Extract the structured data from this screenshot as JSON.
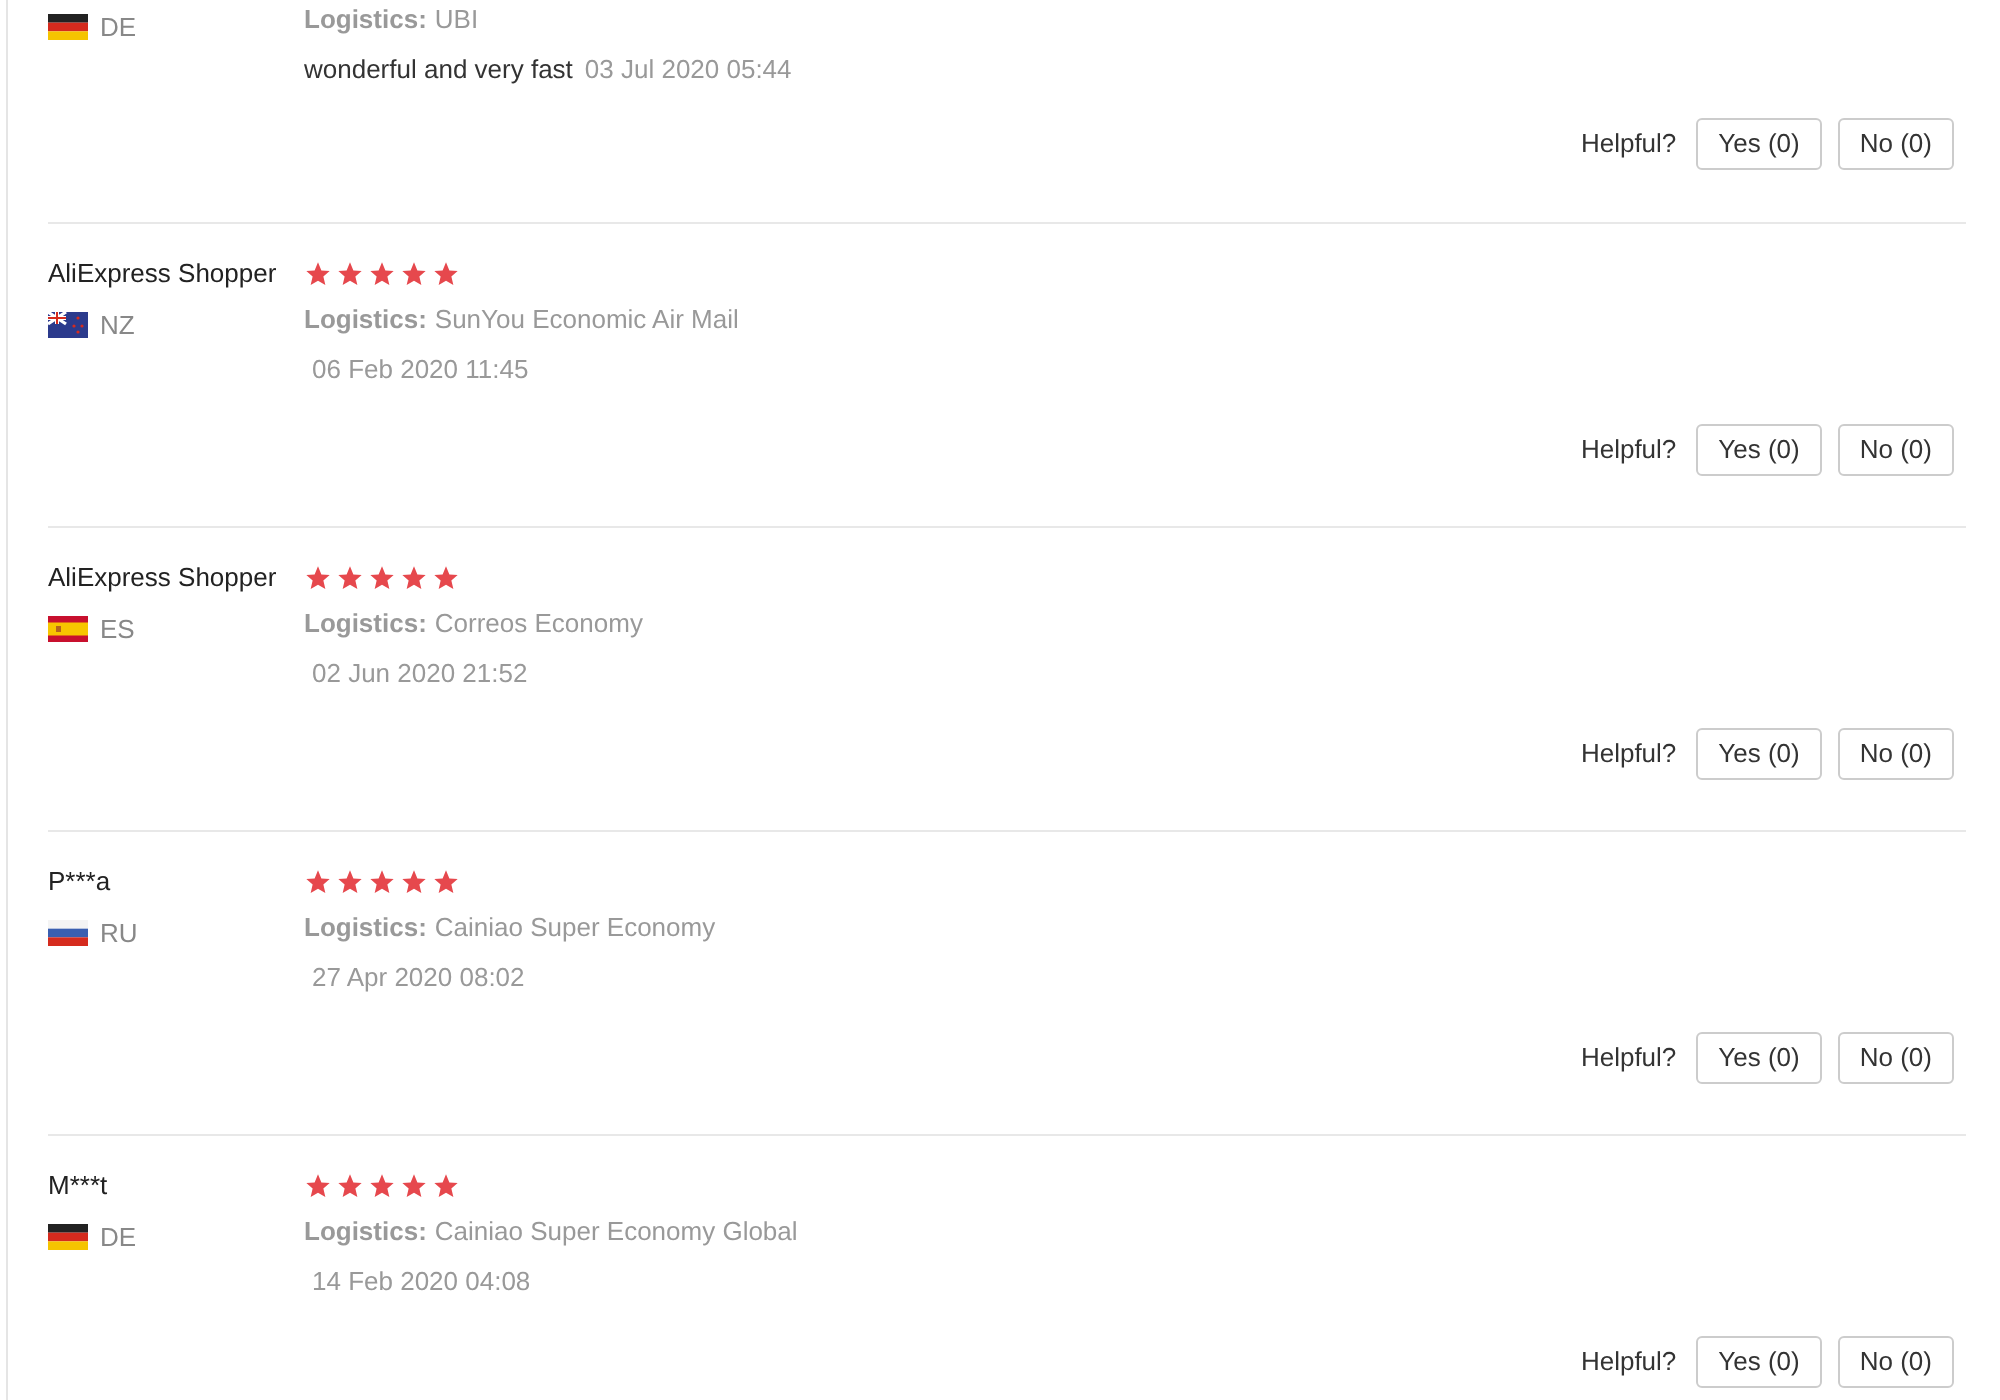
{
  "reviews": [
    {
      "kind": "de",
      "country": "DE",
      "logistics_label": "Logistics:",
      "logistics": "UBI",
      "comment": "wonderful and very fast",
      "date": "03 Jul 2020 05:44",
      "helpful_label": "Helpful?",
      "yes": "Yes (0)",
      "no": "No (0)"
    },
    {
      "name": "AliExpress Shopper",
      "stars": 5,
      "kind": "nz",
      "country": "NZ",
      "logistics_label": "Logistics:",
      "logistics": "SunYou Economic Air Mail",
      "date": "06 Feb 2020 11:45",
      "helpful_label": "Helpful?",
      "yes": "Yes (0)",
      "no": "No (0)"
    },
    {
      "name": "AliExpress Shopper",
      "stars": 5,
      "kind": "es",
      "country": "ES",
      "logistics_label": "Logistics:",
      "logistics": "Correos Economy",
      "date": "02 Jun 2020 21:52",
      "helpful_label": "Helpful?",
      "yes": "Yes (0)",
      "no": "No (0)"
    },
    {
      "name": "P***a",
      "stars": 5,
      "kind": "ru",
      "country": "RU",
      "logistics_label": "Logistics:",
      "logistics": "Cainiao Super Economy",
      "date": "27 Apr 2020 08:02",
      "helpful_label": "Helpful?",
      "yes": "Yes (0)",
      "no": "No (0)"
    },
    {
      "name": "M***t",
      "stars": 5,
      "kind": "de",
      "country": "DE",
      "logistics_label": "Logistics:",
      "logistics": "Cainiao Super Economy Global",
      "date": "14 Feb 2020 04:08",
      "helpful_label": "Helpful?",
      "yes": "Yes (0)",
      "no": "No (0)"
    }
  ]
}
